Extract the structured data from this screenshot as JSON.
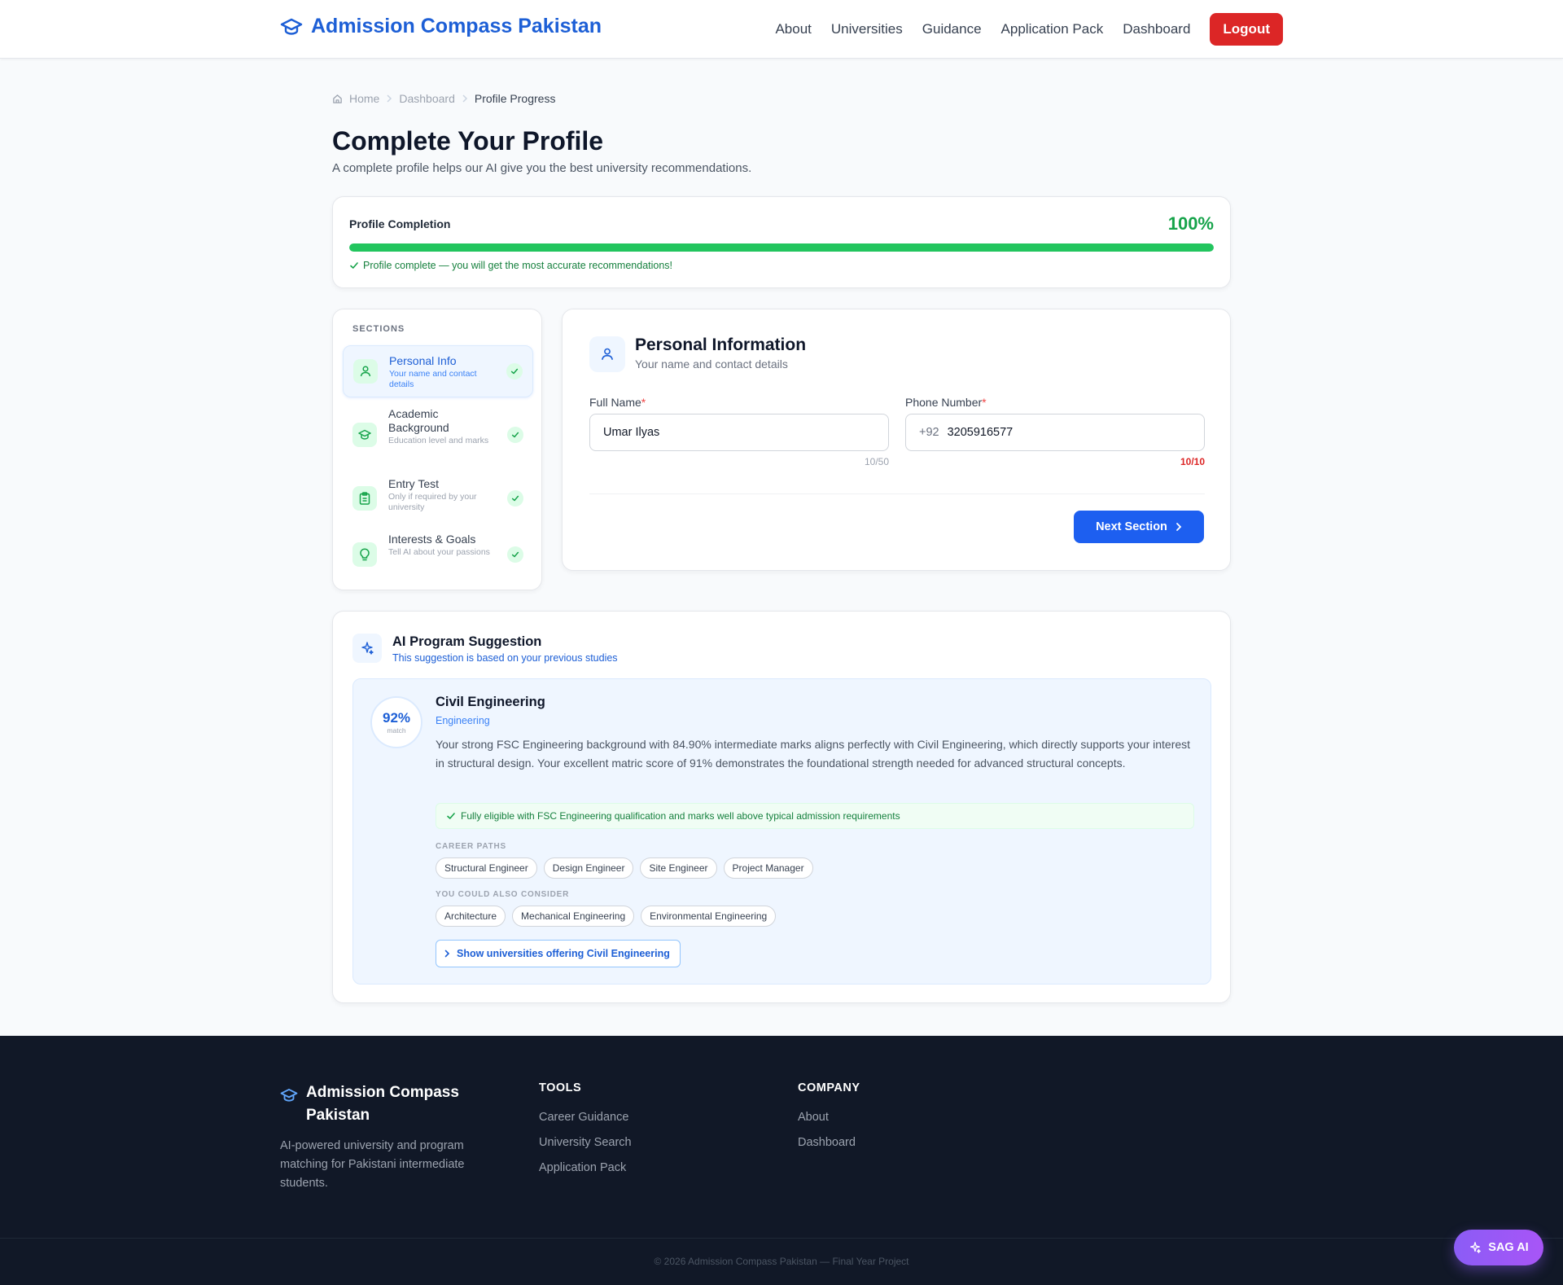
{
  "header": {
    "brand": "Admission Compass Pakistan",
    "nav": [
      "About",
      "Universities",
      "Guidance",
      "Application Pack",
      "Dashboard"
    ],
    "logout": "Logout"
  },
  "breadcrumb": {
    "home": "Home",
    "dashboard": "Dashboard",
    "current": "Profile Progress"
  },
  "page": {
    "title": "Complete Your Profile",
    "subtitle": "A complete profile helps our AI give you the best university recommendations."
  },
  "completion": {
    "label": "Profile Completion",
    "percent_text": "100%",
    "percent": 100,
    "message": "Profile complete — you will get the most accurate recommendations!"
  },
  "sections": {
    "heading": "SECTIONS",
    "items": [
      {
        "title": "Personal Info",
        "desc": "Your name and contact details",
        "icon": "user-icon"
      },
      {
        "title": "Academic Background",
        "desc": "Education level and marks",
        "icon": "graduation-cap-icon"
      },
      {
        "title": "Entry Test",
        "desc": "Only if required by your university",
        "icon": "clipboard-icon"
      },
      {
        "title": "Interests & Goals",
        "desc": "Tell AI about your passions",
        "icon": "lightbulb-icon"
      }
    ]
  },
  "personal": {
    "title": "Personal Information",
    "subtitle": "Your name and contact details",
    "full_name_label": "Full Name",
    "full_name_value": "Umar Ilyas",
    "full_name_counter": "10/50",
    "phone_label": "Phone Number",
    "phone_prefix": "+92",
    "phone_value": "3205916577",
    "phone_counter": "10/10",
    "required_mark": "*",
    "next_label": "Next Section"
  },
  "ai": {
    "title": "AI Program Suggestion",
    "subtitle": "This suggestion is based on your previous studies",
    "match_percent": "92%",
    "match_label": "match",
    "program": "Civil Engineering",
    "field": "Engineering",
    "description": "Your strong FSC Engineering background with 84.90% intermediate marks aligns perfectly with Civil Engineering, which directly supports your interest in structural design. Your excellent matric score of 91% demonstrates the foundational strength needed for advanced structural concepts.",
    "eligibility": "Fully eligible with FSC Engineering qualification and marks well above typical admission requirements",
    "career_head": "CAREER PATHS",
    "careers": [
      "Structural Engineer",
      "Design Engineer",
      "Site Engineer",
      "Project Manager"
    ],
    "consider_head": "YOU COULD ALSO CONSIDER",
    "consider": [
      "Architecture",
      "Mechanical Engineering",
      "Environmental Engineering"
    ],
    "show_label": "Show universities offering Civil Engineering"
  },
  "footer": {
    "brand": "Admission Compass Pakistan",
    "desc": "AI-powered university and program matching for Pakistani intermediate students.",
    "tools_head": "TOOLS",
    "tools": [
      "Career Guidance",
      "University Search",
      "Application Pack"
    ],
    "company_head": "COMPANY",
    "company": [
      "About",
      "Dashboard"
    ],
    "copyright": "© 2026 Admission Compass Pakistan — Final Year Project"
  },
  "sag": {
    "label": "SAG AI"
  },
  "colors": {
    "brand": "#1d5fd6",
    "success": "#22c55e",
    "danger": "#dc2626",
    "primary_button": "#1d5ff0",
    "footer_bg": "#111827"
  }
}
